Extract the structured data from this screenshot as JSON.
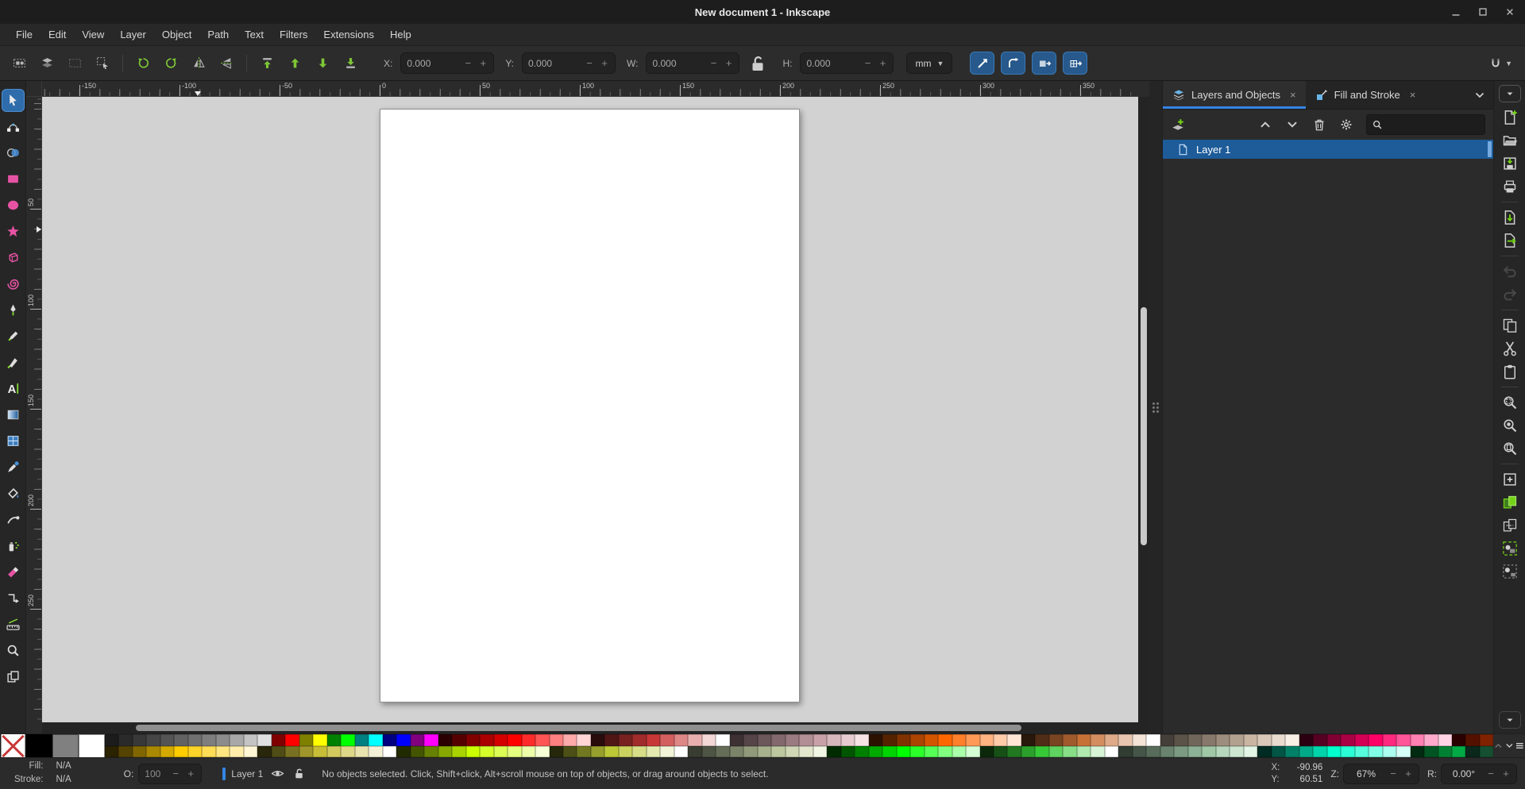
{
  "window": {
    "title": "New document 1 - Inkscape",
    "controls": [
      "minimize",
      "maximize",
      "close"
    ]
  },
  "menubar": [
    "File",
    "Edit",
    "View",
    "Layer",
    "Object",
    "Path",
    "Text",
    "Filters",
    "Extensions",
    "Help"
  ],
  "selection_toolbar": {
    "buttons": [
      "select-all",
      "select-all-layers",
      "deselect",
      "selection-box",
      "rotate-ccw",
      "rotate-cw",
      "flip-horizontal",
      "flip-vertical",
      "raise-to-top",
      "raise",
      "lower",
      "lower-to-bottom"
    ],
    "fields": [
      {
        "label": "X:",
        "value": "0.000"
      },
      {
        "label": "Y:",
        "value": "0.000"
      },
      {
        "label": "W:",
        "value": "0.000"
      },
      {
        "label": "H:",
        "value": "0.000"
      }
    ],
    "lock_icon": "lock-unlocked",
    "units": "mm",
    "toggles": [
      "scale-stroke",
      "scale-corners",
      "move-gradients",
      "move-patterns"
    ],
    "snap_icon": "magnet-snap"
  },
  "toolbox": [
    "selector",
    "node-editor",
    "shape-builder",
    "rectangle",
    "ellipse",
    "star",
    "box-3d",
    "spiral",
    "pen",
    "pencil",
    "calligraphy",
    "text",
    "gradient",
    "mesh-gradient",
    "dropper",
    "paint-bucket",
    "tweak",
    "spray",
    "eraser",
    "connector",
    "measure",
    "zoom",
    "pages"
  ],
  "active_tool": "selector",
  "rulers": {
    "h_labels": [
      "-150",
      "-100",
      "-50",
      "0",
      "50",
      "100",
      "150",
      "200",
      "250",
      "300",
      "350"
    ],
    "v_labels": [
      "50",
      "100",
      "150",
      "200",
      "250"
    ]
  },
  "dock": {
    "tabs": [
      {
        "label": "Layers and Objects",
        "icon": "layers-tab",
        "close": "×",
        "active": true
      },
      {
        "label": "Fill and Stroke",
        "icon": "fill-stroke-tab",
        "close": "×",
        "active": false
      }
    ],
    "toolbar_icons": [
      "add-layer",
      "chevron-up",
      "chevron-down",
      "trash",
      "gear",
      "search"
    ],
    "layers": [
      {
        "name": "Layer 1",
        "selected": true
      }
    ]
  },
  "commandbar": {
    "snap_button": "snap-options",
    "items": [
      {
        "name": "document-new"
      },
      {
        "name": "document-open"
      },
      {
        "name": "document-save"
      },
      {
        "name": "print"
      },
      {
        "name": "import"
      },
      {
        "name": "export"
      },
      {
        "name": "undo",
        "disabled": true
      },
      {
        "name": "redo",
        "disabled": true
      },
      {
        "name": "copy"
      },
      {
        "name": "cut"
      },
      {
        "name": "paste"
      },
      {
        "name": "zoom-selection"
      },
      {
        "name": "zoom-drawing"
      },
      {
        "name": "zoom-page"
      },
      {
        "name": "duplicate"
      },
      {
        "name": "create-clone"
      },
      {
        "name": "unlink-clone"
      },
      {
        "name": "group"
      },
      {
        "name": "ungroup"
      }
    ],
    "overflow": "commandbar-overflow"
  },
  "palette": {
    "none_swatch": "no-color-x",
    "fixed": [
      "#000000",
      "#808080",
      "#ffffff"
    ],
    "row1": [
      "#1c1c1c",
      "#2a2a2a",
      "#383838",
      "#464646",
      "#545454",
      "#626262",
      "#707070",
      "#7e7e7e",
      "#8c8c8c",
      "#a8a8a8",
      "#c4c4c4",
      "#e0e0e0",
      "#800000",
      "#ff0000",
      "#808000",
      "#ffff00",
      "#008000",
      "#00ff00",
      "#008080",
      "#00ffff",
      "#000080",
      "#0000ff",
      "#800080",
      "#ff00ff",
      "#2b0000",
      "#550000",
      "#800000",
      "#aa0000",
      "#d40000",
      "#ff0000",
      "#ff2a2a",
      "#ff5555",
      "#ff8080",
      "#ffaaaa",
      "#ffd5d5",
      "#280b0b",
      "#501616",
      "#782121",
      "#a02c2c",
      "#c83737",
      "#d35f5f",
      "#de8787",
      "#e9afaf",
      "#f4d7d7",
      "#ffffff",
      "#3d3133",
      "#554548",
      "#6c575b",
      "#83696e",
      "#9a7b81",
      "#b18d94",
      "#c8a0a7",
      "#d7b6bc",
      "#e6ccd0",
      "#f5e3e5",
      "#2b1100",
      "#552200",
      "#803300",
      "#aa4400",
      "#d45500",
      "#ff6600",
      "#ff7f2a",
      "#ff9955",
      "#ffb380",
      "#ffccaa",
      "#ffe6d5",
      "#28170b",
      "#502d16",
      "#784421",
      "#a05a2c",
      "#c87137",
      "#d38d5f",
      "#deaa87",
      "#e9c6af",
      "#f4e3d7",
      "#ffffff",
      "#453f3a",
      "#5b5248",
      "#71665a",
      "#87796c",
      "#9d8d7e",
      "#b3a190",
      "#c9b5a2",
      "#d9c8b8",
      "#e9dccf",
      "#f9f0e6",
      "#2b0011",
      "#550022",
      "#800033",
      "#aa0044",
      "#d40055",
      "#ff0066",
      "#ff2a7f",
      "#ff5599",
      "#ff80b2",
      "#ffaacc",
      "#ffd5e5",
      "#2b0000",
      "#551100",
      "#802200"
    ],
    "row2": [
      "#2b2200",
      "#554400",
      "#806600",
      "#aa8800",
      "#d4aa00",
      "#ffcc00",
      "#ffd42a",
      "#ffdd55",
      "#ffe680",
      "#ffeeaa",
      "#fff6d5",
      "#28260b",
      "#504c16",
      "#787121",
      "#a0972c",
      "#c8bd37",
      "#d3ca5f",
      "#ded787",
      "#e9e4af",
      "#f4f1d7",
      "#ffffff",
      "#222b00",
      "#445500",
      "#668000",
      "#88aa00",
      "#aad400",
      "#ccff00",
      "#d4ff2a",
      "#ddff55",
      "#e5ff80",
      "#eeffaa",
      "#f6ffd5",
      "#26280b",
      "#4c5016",
      "#717821",
      "#97a02c",
      "#bdc837",
      "#cad35f",
      "#d7de87",
      "#e4e9af",
      "#f1f4d7",
      "#ffffff",
      "#393d31",
      "#4f5545",
      "#656c57",
      "#7b8369",
      "#919a7b",
      "#a7b18d",
      "#bdc8a0",
      "#d0d7b6",
      "#e2e6cc",
      "#f1f5e3",
      "#002b00",
      "#005500",
      "#008000",
      "#00aa00",
      "#00d400",
      "#00ff00",
      "#2aff2a",
      "#55ff55",
      "#80ff80",
      "#aaffaa",
      "#d5ffd5",
      "#0b280b",
      "#165016",
      "#217821",
      "#2ca02c",
      "#37c837",
      "#5fd35f",
      "#87de87",
      "#afe9af",
      "#d7f4d7",
      "#ffffff",
      "#313d33",
      "#455548",
      "#576c5b",
      "#69836e",
      "#7b9a81",
      "#8db194",
      "#a0c8a7",
      "#b6d7bc",
      "#cce6d0",
      "#e3f5e5",
      "#002b22",
      "#005544",
      "#008066",
      "#00aa88",
      "#00d4aa",
      "#00ffcc",
      "#2affd5",
      "#55ffdd",
      "#80ffe6",
      "#aaffee",
      "#d5fff6",
      "#002b11",
      "#005522",
      "#008033",
      "#00aa44",
      "#0b281c",
      "#165032"
    ],
    "controls": [
      "palette-scroll-up",
      "palette-scroll-down",
      "palette-menu"
    ]
  },
  "statusbar": {
    "fill_label": "Fill:",
    "fill_value": "N/A",
    "stroke_label": "Stroke:",
    "stroke_value": "N/A",
    "opacity_label": "O:",
    "opacity_value": "100",
    "layer_indicator_color": "#3584e4",
    "layer_name": "Layer 1",
    "icons": [
      "eye-visibility",
      "lock-unlocked"
    ],
    "message": "No objects selected. Click, Shift+click, Alt+scroll mouse on top of objects, or drag around objects to select.",
    "x_label": "X:",
    "x_value": "-90.96",
    "y_label": "Y:",
    "y_value": "60.51",
    "zoom_label": "Z:",
    "zoom_value": "67%",
    "rotation_label": "R:",
    "rotation_value": "0.00°"
  },
  "colors": {
    "accent": "#3584e4",
    "shape_pink": "#e753a4",
    "green_accent": "#8ae234",
    "canvas_desk": "#d2d2d2",
    "page": "#ffffff"
  }
}
